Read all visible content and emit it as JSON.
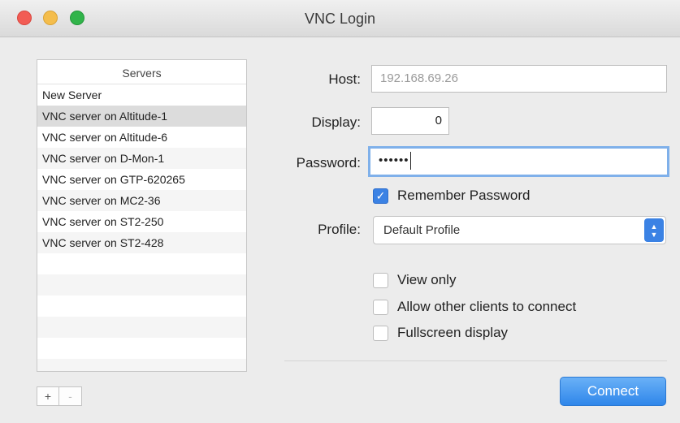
{
  "window": {
    "title": "VNC Login"
  },
  "servers": {
    "header": "Servers",
    "items": [
      "New Server",
      "VNC server on Altitude-1",
      "VNC server on Altitude-6",
      "VNC server on D-Mon-1",
      "VNC server on GTP-620265",
      "VNC server on MC2-36",
      "VNC server on ST2-250",
      "VNC server on ST2-428"
    ],
    "selected_index": 1,
    "add_label": "+",
    "remove_label": "-"
  },
  "form": {
    "host_label": "Host:",
    "host_value": "192.168.69.26",
    "display_label": "Display:",
    "display_value": "0",
    "password_label": "Password:",
    "password_masked": "••••••",
    "remember_label": "Remember Password",
    "remember_checked": true,
    "profile_label": "Profile:",
    "profile_value": "Default Profile",
    "options": [
      {
        "label": "View only",
        "checked": false
      },
      {
        "label": "Allow other clients to connect",
        "checked": false
      },
      {
        "label": "Fullscreen display",
        "checked": false
      }
    ],
    "connect_label": "Connect"
  },
  "colors": {
    "accent": "#3b82e4",
    "close": "#f25c54",
    "minimize": "#f4bd4c",
    "maximize": "#31b44a"
  },
  "icons": {
    "checkmark": "checkmark-icon",
    "select_arrows": "up-down-chevron-icon"
  }
}
